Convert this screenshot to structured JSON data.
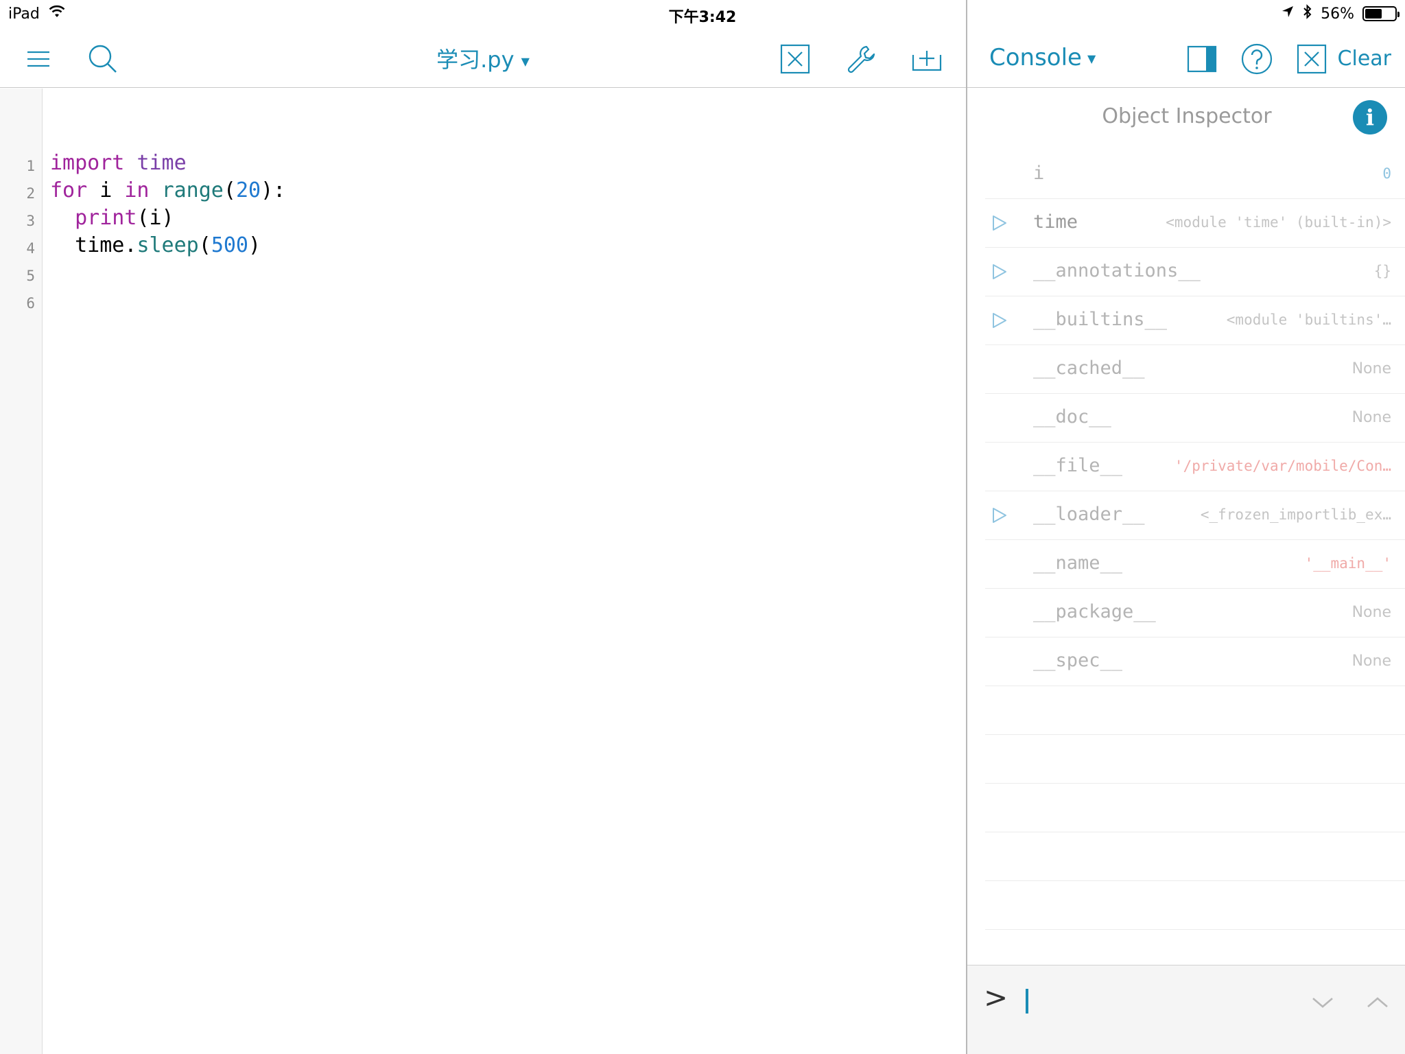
{
  "status_bar": {
    "device": "iPad",
    "time": "下午3:42",
    "battery": "56%",
    "battery_level": 0.56
  },
  "editor": {
    "file_title": "学习.py",
    "icons": [
      "menu-icon",
      "search-icon",
      "close-file-icon",
      "wrench-icon",
      "new-file-icon"
    ],
    "line_numbers": [
      "1",
      "2",
      "3",
      "4",
      "5",
      "6"
    ],
    "code": {
      "l1_kw": "import",
      "l1_mod": "time",
      "l2_kw1": "for",
      "l2_var": "i",
      "l2_kw2": "in",
      "l2_fn": "range",
      "l2_open": "(",
      "l2_num": "20",
      "l2_close": "):",
      "l3_fn": "print",
      "l3_args": "(i)",
      "l4_obj": "time.",
      "l4_fn": "sleep",
      "l4_open": "(",
      "l4_num": "500",
      "l4_close": ")"
    }
  },
  "console": {
    "title": "Console",
    "clear_label": "Clear",
    "inspector_title": "Object Inspector",
    "info_label": "i",
    "prompt": ">",
    "rows": [
      {
        "name": "i",
        "value": "0"
      },
      {
        "name": "time",
        "value": "<module 'time' (built-in)>"
      },
      {
        "name": "__annotations__",
        "value": "{}"
      },
      {
        "name": "__builtins__",
        "value": "<module 'builtins'…"
      },
      {
        "name": "__cached__",
        "value": "None"
      },
      {
        "name": "__doc__",
        "value": "None"
      },
      {
        "name": "__file__",
        "value": "'/private/var/mobile/Con…"
      },
      {
        "name": "__loader__",
        "value": "<_frozen_importlib_ex…"
      },
      {
        "name": "__name__",
        "value": "'__main__'"
      },
      {
        "name": "__package__",
        "value": "None"
      },
      {
        "name": "__spec__",
        "value": "None"
      }
    ]
  },
  "colors": {
    "accent": "#1a8cb5",
    "keyword": "#a0249c",
    "function": "#1f7a7a",
    "number": "#1f79d0"
  }
}
